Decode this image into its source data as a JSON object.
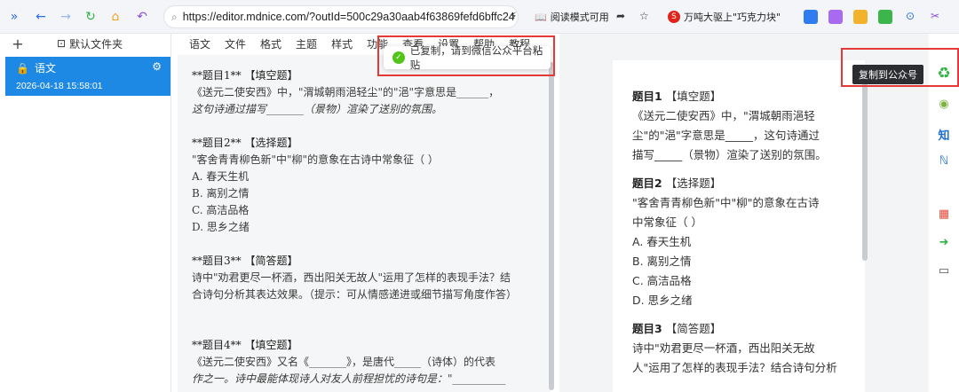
{
  "browser": {
    "url": "https://editor.mdnice.com/?outId=500c29a30aab4f63869fefd6bffc24",
    "reader_mode": "阅读模式可用",
    "news": "万吨大驱上\"巧克力块\""
  },
  "sidebar": {
    "new_folder": "默认文件夹",
    "items": [
      {
        "title": "语文",
        "date": "2026-04-18 15:58:01"
      }
    ]
  },
  "menu": [
    "语文",
    "文件",
    "格式",
    "主题",
    "样式",
    "功能",
    "查看",
    "设置",
    "帮助",
    "教程"
  ],
  "toast": "已复制，请到微信公众平台粘贴",
  "tooltip": "复制到公众号",
  "editor": {
    "q1_title": "**题目1** 【填空题】",
    "q1_line1": "《送元二使安西》中，\"渭城朝雨浥轻尘\"的\"浥\"字意思是______，",
    "q1_line2": "这句诗通过描写_______（景物）渲染了送别的氛围。",
    "q2_title": "**题目2** 【选择题】",
    "q2_line1": "\"客舍青青柳色新\"中\"柳\"的意象在古诗中常象征（ ）",
    "q2_a": "A. 春天生机",
    "q2_b": "B. 离别之情",
    "q2_c": "C. 高洁品格",
    "q2_d": "D. 思乡之绪",
    "q3_title": "**题目3** 【简答题】",
    "q3_line1": "诗中\"劝君更尽一杯酒，西出阳关无故人\"运用了怎样的表现手法？结",
    "q3_line2": "合诗句分析其表达效果。（提示：可从情感递进或细节描写角度作答）",
    "q4_title": "**题目4** 【填空题】",
    "q4_line1": "《送元二使安西》又名《_______》，是唐代_____（诗体）的代表",
    "q4_line2": "作之一。诗中最能体现诗人对友人前程担忧的诗句是：\"__________"
  },
  "preview": {
    "q1_title": "题目1",
    "q1_type": "【填空题】",
    "q1_line1": "《送元二使安西》中，\"渭城朝雨浥轻",
    "q1_line2": "尘\"的\"浥\"字意思是_____，这句诗通过",
    "q1_line3": "描写_____（景物）渲染了送别的氛围。",
    "q2_title": "题目2",
    "q2_type": "【选择题】",
    "q2_line1": "\"客舍青青柳色新\"中\"柳\"的意象在古诗",
    "q2_line2": "中常象征（ ）",
    "q2_a": "A. 春天生机",
    "q2_b": "B. 离别之情",
    "q2_c": "C. 高洁品格",
    "q2_d": "D. 思乡之绪",
    "q3_title": "题目3",
    "q3_type": "【简答题】",
    "q3_line1": "诗中\"劝君更尽一杯酒，西出阳关无故",
    "q3_line2": "人\"运用了怎样的表现手法？结合诗句分析"
  }
}
